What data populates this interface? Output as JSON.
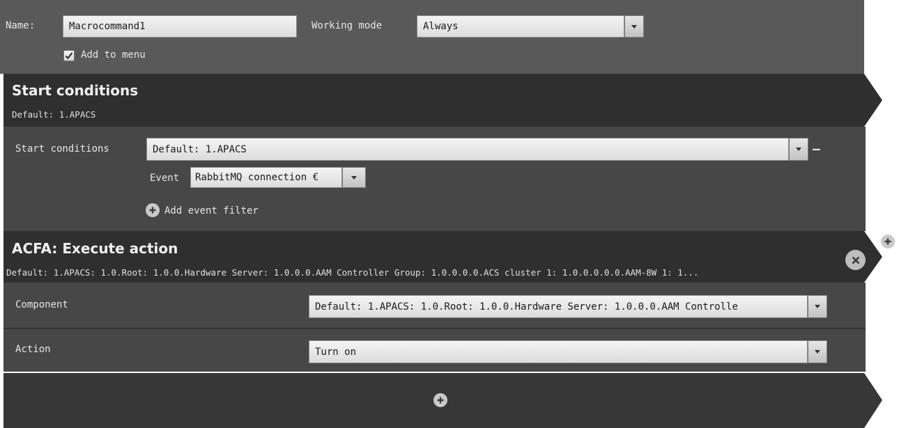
{
  "top": {
    "name_label": "Name:",
    "name_value": "Macrocommand1",
    "working_mode_label": "Working mode",
    "working_mode_value": "Always",
    "add_to_menu_label": "Add to menu",
    "add_to_menu_checked": true
  },
  "start_block": {
    "title": "Start conditions",
    "subtitle": "Default: 1.APACS",
    "field_label": "Start conditions",
    "field_value": "Default: 1.APACS",
    "remove_symbol": "—",
    "event_label": "Event",
    "event_value": "RabbitMQ connection €",
    "add_filter_label": "Add event filter"
  },
  "action_block": {
    "title": "ACFA: Execute action",
    "subtitle": "Default: 1.APACS: 1.0.Root: 1.0.0.Hardware Server: 1.0.0.0.AAM Controller Group: 1.0.0.0.0.ACS cluster 1: 1.0.0.0.0.0.AAM-8W 1: 1...",
    "component_label": "Component",
    "component_value": "Default: 1.APACS: 1.0.Root: 1.0.0.Hardware Server: 1.0.0.0.AAM Controlle",
    "action_label": "Action",
    "action_value": "Turn on"
  },
  "icons": {
    "add_step": "plus-circle-icon",
    "remove_action": "close-circle-icon",
    "add_filter": "plus-circle-icon",
    "dropdown": "chevron-down-icon",
    "check": "checkmark-icon"
  }
}
